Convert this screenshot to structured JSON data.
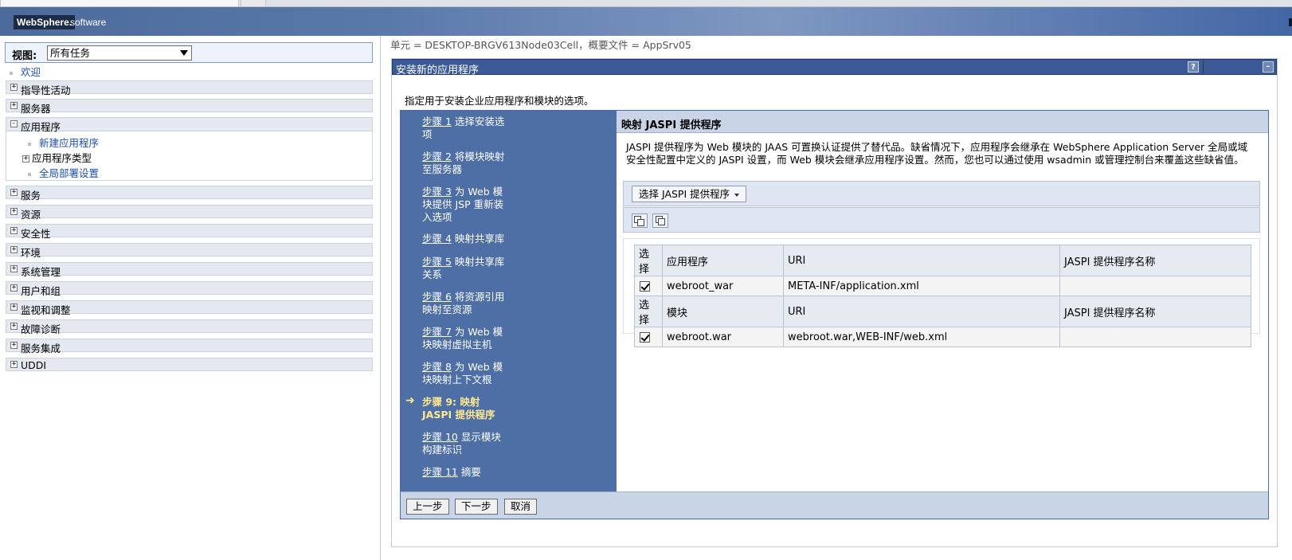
{
  "banner": {
    "logo": "WebSphere.",
    "logo_suffix": "software"
  },
  "sidebar": {
    "view_label": "视图:",
    "view_value": "所有任务",
    "welcome": "欢迎",
    "items": [
      {
        "label": "指导性活动",
        "state": "+"
      },
      {
        "label": "服务器",
        "state": "+"
      },
      {
        "label": "应用程序",
        "state": "-"
      },
      {
        "label": "服务",
        "state": "+"
      },
      {
        "label": "资源",
        "state": "+"
      },
      {
        "label": "安全性",
        "state": "+"
      },
      {
        "label": "环境",
        "state": "+"
      },
      {
        "label": "系统管理",
        "state": "+"
      },
      {
        "label": "用户和组",
        "state": "+"
      },
      {
        "label": "监视和调整",
        "state": "+"
      },
      {
        "label": "故障诊断",
        "state": "+"
      },
      {
        "label": "服务集成",
        "state": "+"
      },
      {
        "label": "UDDI",
        "state": "+"
      }
    ],
    "app_children": {
      "new_app": "新建应用程序",
      "app_types": "应用程序类型",
      "app_types_state": "+",
      "global_deploy": "全局部署设置"
    }
  },
  "main": {
    "cell_info": "单元 = DESKTOP-BRGV613Node03Cell，概要文件 = AppSrv05",
    "portlet_title": "安装新的应用程序",
    "help_icon": "?",
    "min_icon": "–",
    "intro": "指定用于安装企业应用程序和模块的选项。",
    "steps": [
      {
        "num": "步骤 1",
        "text": " 选择安装选",
        "text2": "项"
      },
      {
        "num": "步骤 2",
        "text": " 将模块映射",
        "text2": "至服务器"
      },
      {
        "num": "步骤 3",
        "text": " 为 Web 模",
        "text2": "块提供 JSP 重新装",
        "text3": "入选项"
      },
      {
        "num": "步骤 4",
        "text": " 映射共享库"
      },
      {
        "num": "步骤 5",
        "text": " 映射共享库",
        "text2": "关系"
      },
      {
        "num": "步骤 6",
        "text": " 将资源引用",
        "text2": "映射至资源"
      },
      {
        "num": "步骤 7",
        "text": " 为 Web 模",
        "text2": "块映射虚拟主机"
      },
      {
        "num": "步骤 8",
        "text": " 为 Web 模",
        "text2": "块映射上下文根"
      },
      {
        "num": "步骤 9: 映射",
        "text2": "JASPI 提供程序"
      },
      {
        "num": "步骤 10",
        "text": " 显示模块",
        "text2": "构建标识"
      },
      {
        "num": "步骤 11",
        "text": " 摘要"
      }
    ],
    "current_arrow": "➜",
    "section_title": "映射 JASPI 提供程序",
    "description": "JASPI 提供程序为 Web 模块的 JAAS 可置换认证提供了替代品。缺省情况下，应用程序会继承在 WebSphere Application Server 全局或域安全性配置中定义的 JASPI 设置，而 Web 模块会继承应用程序设置。然而，您也可以通过使用 wsadmin 或管理控制台来覆盖这些缺省值。",
    "select_provider_button": "选择 JASPI 提供程序",
    "table": {
      "app_headers": [
        "选择",
        "应用程序",
        "URI",
        "JASPI 提供程序名称"
      ],
      "app_row": {
        "checked": true,
        "name": "webroot_war",
        "uri": "META-INF/application.xml",
        "provider": ""
      },
      "module_headers": [
        "选择",
        "模块",
        "URI",
        "JASPI 提供程序名称"
      ],
      "module_row": {
        "checked": true,
        "name": "webroot.war",
        "uri": "webroot.war,WEB-INF/web.xml",
        "provider": ""
      }
    },
    "buttons": {
      "prev": "上一步",
      "next": "下一步",
      "cancel": "取消"
    }
  }
}
